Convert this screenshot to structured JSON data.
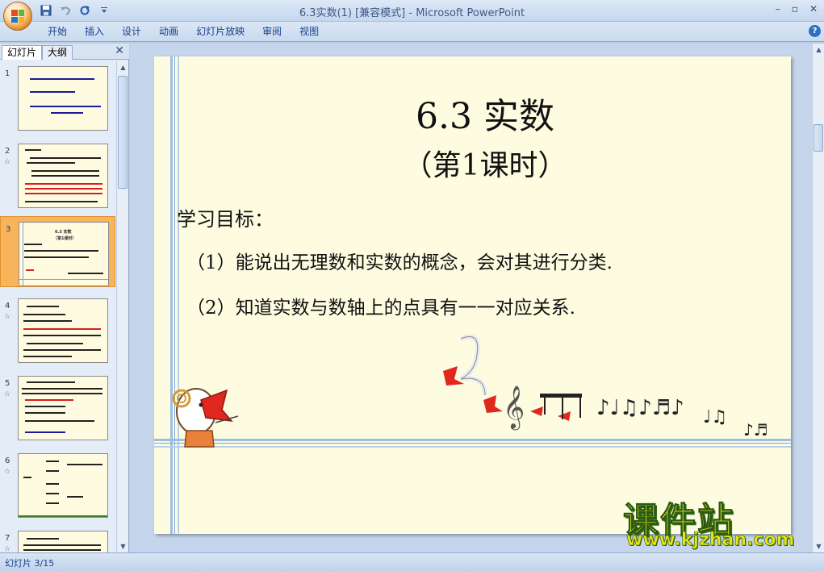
{
  "window": {
    "title": "6.3实数(1) [兼容模式] - Microsoft PowerPoint",
    "minimize": "–",
    "restore": "▫",
    "close": "✕"
  },
  "quick_access": {
    "save_icon": "save-icon",
    "undo_icon": "undo-icon",
    "redo_icon": "redo-icon",
    "customize_icon": "customize-icon"
  },
  "ribbon": {
    "tabs": [
      "开始",
      "插入",
      "设计",
      "动画",
      "幻灯片放映",
      "审阅",
      "视图"
    ],
    "help": "?"
  },
  "left_panel": {
    "tab_slides": "幻灯片",
    "tab_outline": "大纲",
    "close": "✕",
    "thumbnails": [
      {
        "num": "1",
        "anim": ""
      },
      {
        "num": "2",
        "anim": "☆"
      },
      {
        "num": "3",
        "anim": ""
      },
      {
        "num": "4",
        "anim": "☆"
      },
      {
        "num": "5",
        "anim": "☆"
      },
      {
        "num": "6",
        "anim": "☆"
      },
      {
        "num": "7",
        "anim": "☆"
      }
    ],
    "thumb3_title": "6.3 实数",
    "thumb3_sub": "（第1课时）"
  },
  "slide": {
    "title": "6.3  实数",
    "subtitle": "（第1课时）",
    "objectives_heading": "学习目标：",
    "objective_1": "（1）能说出无理数和实数的概念，会对其进行分类.",
    "objective_2": "（2）知道实数与数轴上的点具有一一对应关系."
  },
  "watermark": {
    "text": "课件站",
    "url": "www.kjzhan.com"
  },
  "status": {
    "slide_info": "幻灯片 3/15"
  },
  "colors": {
    "slide_bg": "#fdfce0",
    "accent_blue": "#7fa6d8",
    "ribbon_text": "#15428b",
    "selected_thumb": "#f7b45a"
  }
}
